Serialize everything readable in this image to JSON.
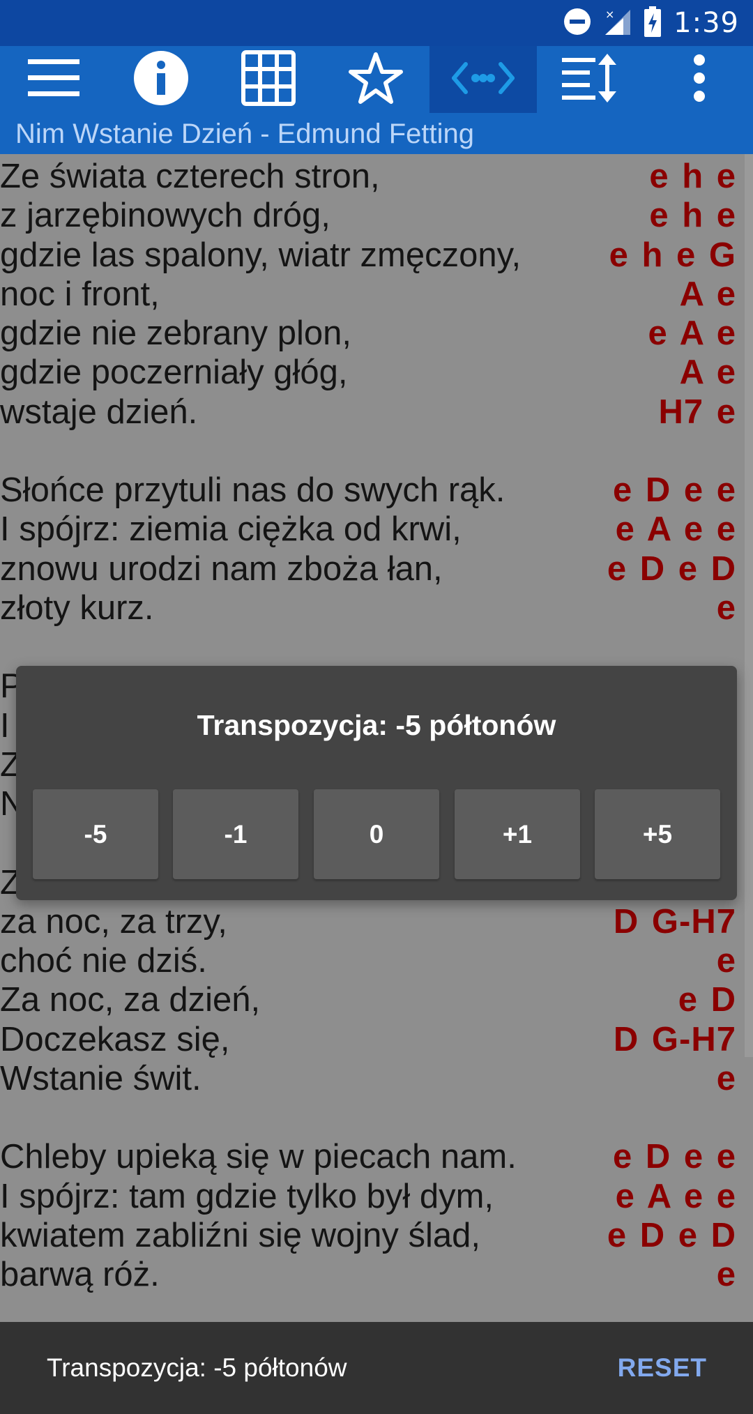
{
  "status_bar": {
    "time": "1:39",
    "icons": [
      "do-not-disturb-icon",
      "no-signal-icon",
      "battery-charging-icon"
    ]
  },
  "toolbar": {
    "buttons": [
      "menu-icon",
      "info-icon",
      "grid-icon",
      "star-icon",
      "transpose-icon",
      "autoscroll-icon",
      "more-vert-icon"
    ],
    "active": "transpose-icon",
    "subtitle": "Nim Wstanie Dzień - Edmund Fetting"
  },
  "song": {
    "lines": [
      {
        "lyric": "Ze świata czterech stron,",
        "chords": "e h e"
      },
      {
        "lyric": "z jarzębinowych dróg,",
        "chords": "e h e"
      },
      {
        "lyric": "gdzie las spalony, wiatr zmęczony,",
        "chords": "e h e G"
      },
      {
        "lyric": "noc i front,",
        "chords": "A e"
      },
      {
        "lyric": "gdzie nie zebrany plon,",
        "chords": "e A e"
      },
      {
        "lyric": "gdzie poczerniały głóg,",
        "chords": "A e"
      },
      {
        "lyric": "wstaje dzień.",
        "chords": "H7 e"
      },
      {
        "lyric": "",
        "chords": ""
      },
      {
        "lyric": "Słońce przytuli nas do swych rąk.",
        "chords": "e D e e"
      },
      {
        "lyric": "I spójrz: ziemia ciężka od krwi,",
        "chords": "e A e e"
      },
      {
        "lyric": "znowu urodzi nam zboża łan,",
        "chords": "e D e D"
      },
      {
        "lyric": "złoty kurz.",
        "chords": "e"
      },
      {
        "lyric": "",
        "chords": ""
      },
      {
        "lyric": "P",
        "chords": ""
      },
      {
        "lyric": "I",
        "chords": ""
      },
      {
        "lyric": "Z",
        "chords": ""
      },
      {
        "lyric": "N",
        "chords": ""
      },
      {
        "lyric": "",
        "chords": ""
      },
      {
        "lyric": "Z",
        "chords": ""
      },
      {
        "lyric": "za noc, za trzy,",
        "chords": "D G-H7"
      },
      {
        "lyric": "choć nie dziś.",
        "chords": "e"
      },
      {
        "lyric": "Za noc, za dzień,",
        "chords": "e D"
      },
      {
        "lyric": "Doczekasz się,",
        "chords": "D G-H7"
      },
      {
        "lyric": "Wstanie świt.",
        "chords": "e"
      },
      {
        "lyric": "",
        "chords": ""
      },
      {
        "lyric": "Chleby upieką się w piecach nam.",
        "chords": "e D e e"
      },
      {
        "lyric": "I spójrz: tam gdzie tylko był dym,",
        "chords": "e A e e"
      },
      {
        "lyric": "kwiatem zabliźni się wojny ślad,",
        "chords": "e D e D"
      },
      {
        "lyric": "barwą róż.",
        "chords": "e"
      }
    ]
  },
  "dialog": {
    "title": "Transpozycja: -5 półtonów",
    "buttons": [
      "-5",
      "-1",
      "0",
      "+1",
      "+5"
    ]
  },
  "snackbar": {
    "text": "Transpozycja: -5 półtonów",
    "action": "RESET"
  }
}
